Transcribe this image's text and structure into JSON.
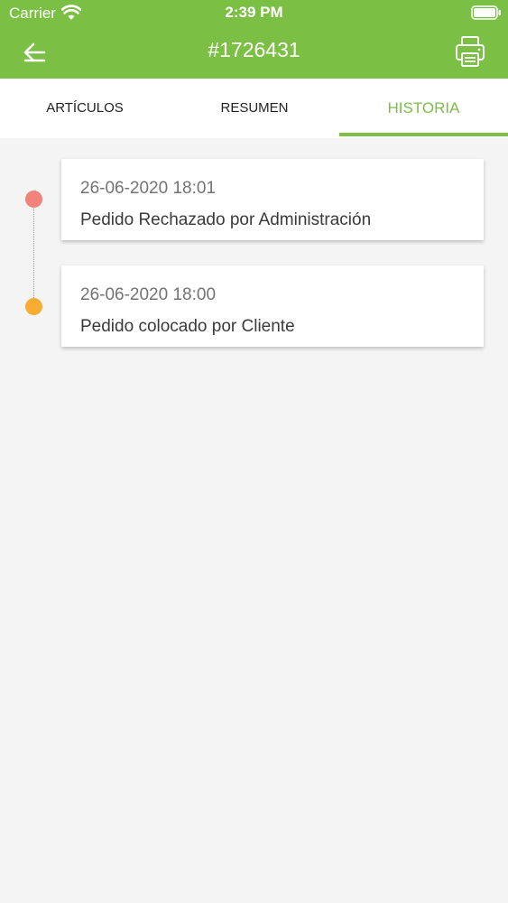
{
  "status_bar": {
    "carrier": "Carrier",
    "time": "2:39 PM",
    "wifi_icon": "wifi-icon",
    "battery_icon": "battery-icon"
  },
  "nav": {
    "back_icon": "arrow-left-icon",
    "title": "#1726431",
    "print_icon": "printer-icon"
  },
  "tabs": [
    {
      "label": "ARTÍCULOS",
      "active": false
    },
    {
      "label": "RESUMEN",
      "active": false
    },
    {
      "label": "HISTORIA",
      "active": true
    }
  ],
  "history": [
    {
      "date": "26-06-2020 18:01",
      "description": "Pedido Rechazado por Administración",
      "dot_color": "#f2837b"
    },
    {
      "date": "26-06-2020 18:00",
      "description": "Pedido colocado por Cliente",
      "dot_color": "#f7ad34"
    }
  ],
  "colors": {
    "accent": "#7bbf45",
    "background": "#f4f4f4"
  }
}
